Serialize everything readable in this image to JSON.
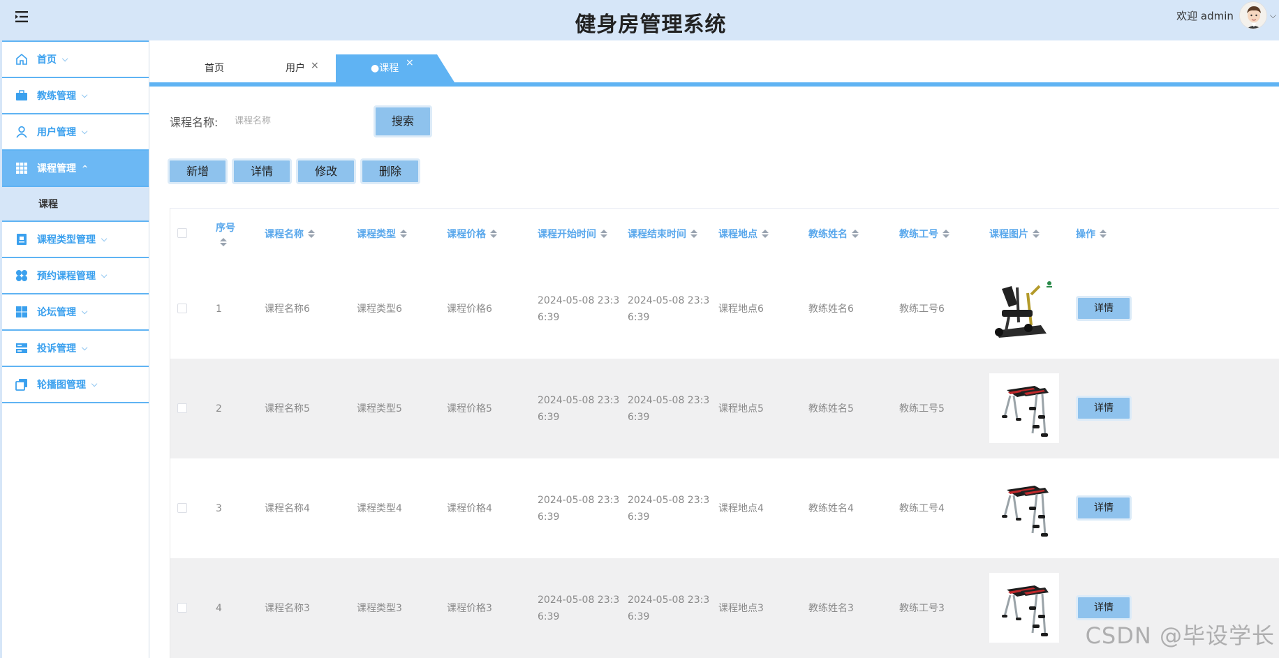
{
  "header": {
    "title": "健身房管理系统",
    "welcome": "欢迎 admin",
    "user_caret": "⌵"
  },
  "sidebar": {
    "items": [
      {
        "label": "首页",
        "icon": "home-icon"
      },
      {
        "label": "教练管理",
        "icon": "briefcase-icon"
      },
      {
        "label": "用户管理",
        "icon": "user-icon"
      },
      {
        "label": "课程管理",
        "icon": "grid-icon",
        "active": true
      },
      {
        "label": "课程类型管理",
        "icon": "card-icon"
      },
      {
        "label": "预约课程管理",
        "icon": "flower-icon"
      },
      {
        "label": "论坛管理",
        "icon": "windows-icon"
      },
      {
        "label": "投诉管理",
        "icon": "list-icon"
      },
      {
        "label": "轮播图管理",
        "icon": "copy-icon"
      }
    ],
    "submenu": {
      "label": "课程"
    },
    "chevron_down": "⌵",
    "chevron_up": "^"
  },
  "tabs": {
    "items": [
      {
        "label": "首页"
      },
      {
        "label": "用户",
        "close": "×"
      },
      {
        "label": "●课程",
        "close": "×",
        "active": true
      }
    ]
  },
  "search": {
    "label": "课程名称:",
    "placeholder": "课程名称",
    "button": "搜索"
  },
  "actions": {
    "add": "新增",
    "detail": "详情",
    "edit": "修改",
    "delete": "删除"
  },
  "table": {
    "columns": [
      "序号",
      "课程名称",
      "课程类型",
      "课程价格",
      "课程开始时间",
      "课程结束时间",
      "课程地点",
      "教练姓名",
      "教练工号",
      "课程图片",
      "操作"
    ],
    "rows": [
      {
        "idx": "1",
        "name": "课程名称6",
        "type": "课程类型6",
        "price": "课程价格6",
        "start": "2024-05-08 23:36:39",
        "end": "2024-05-08 23:36:39",
        "place": "课程地点6",
        "coach": "教练姓名6",
        "coach_id": "教练工号6",
        "image": "machine",
        "op": "详情"
      },
      {
        "idx": "2",
        "name": "课程名称5",
        "type": "课程类型5",
        "price": "课程价格5",
        "start": "2024-05-08 23:36:39",
        "end": "2024-05-08 23:36:39",
        "place": "课程地点5",
        "coach": "教练姓名5",
        "coach_id": "教练工号5",
        "image": "bench",
        "op": "详情"
      },
      {
        "idx": "3",
        "name": "课程名称4",
        "type": "课程类型4",
        "price": "课程价格4",
        "start": "2024-05-08 23:36:39",
        "end": "2024-05-08 23:36:39",
        "place": "课程地点4",
        "coach": "教练姓名4",
        "coach_id": "教练工号4",
        "image": "bench",
        "op": "详情"
      },
      {
        "idx": "4",
        "name": "课程名称3",
        "type": "课程类型3",
        "price": "课程价格3",
        "start": "2024-05-08 23:36:39",
        "end": "2024-05-08 23:36:39",
        "place": "课程地点3",
        "coach": "教练姓名3",
        "coach_id": "教练工号3",
        "image": "bench",
        "op": "详情"
      }
    ]
  },
  "watermark": "CSDN @毕设学长"
}
